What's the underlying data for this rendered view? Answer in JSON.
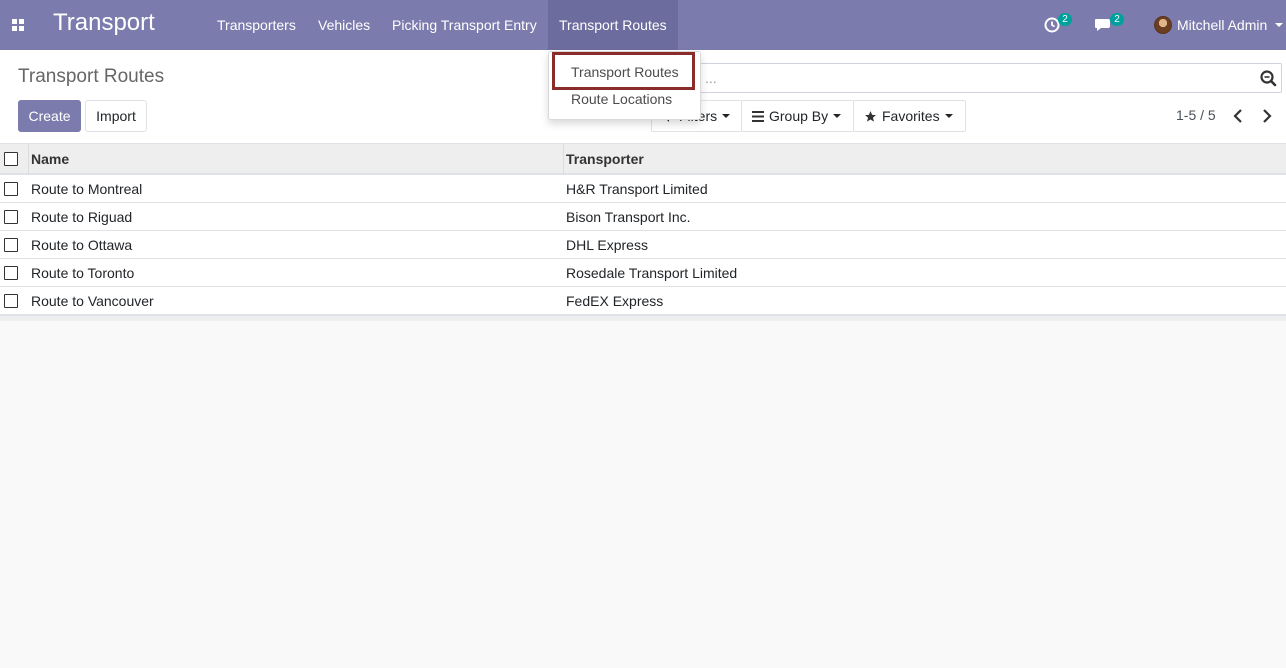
{
  "navbar": {
    "brand": "Transport",
    "menu": {
      "transporters": "Transporters",
      "vehicles": "Vehicles",
      "picking_entry": "Picking Transport Entry",
      "transport_routes": "Transport Routes"
    },
    "activity_count": "2",
    "messages_count": "2",
    "user_name": "Mitchell Admin"
  },
  "dropdown": {
    "items": [
      "Transport Routes",
      "Route Locations"
    ]
  },
  "control_panel": {
    "breadcrumb": "Transport Routes",
    "create_label": "Create",
    "import_label": "Import",
    "search_placeholder": "...",
    "filters_label": "Filters",
    "group_by_label": "Group By",
    "favorites_label": "Favorites",
    "pager": "1-5 / 5"
  },
  "list": {
    "columns": [
      "Name",
      "Transporter"
    ],
    "rows": [
      {
        "name": "Route to Montreal",
        "transporter": "H&R Transport Limited"
      },
      {
        "name": "Route to Riguad",
        "transporter": "Bison Transport Inc."
      },
      {
        "name": "Route to Ottawa",
        "transporter": "DHL Express"
      },
      {
        "name": "Route to Toronto",
        "transporter": "Rosedale Transport Limited"
      },
      {
        "name": "Route to Vancouver",
        "transporter": "FedEX Express"
      }
    ]
  },
  "colors": {
    "navbar": "#7c7bad",
    "badge": "#00a09d",
    "highlight_border": "#8b2c2c"
  }
}
